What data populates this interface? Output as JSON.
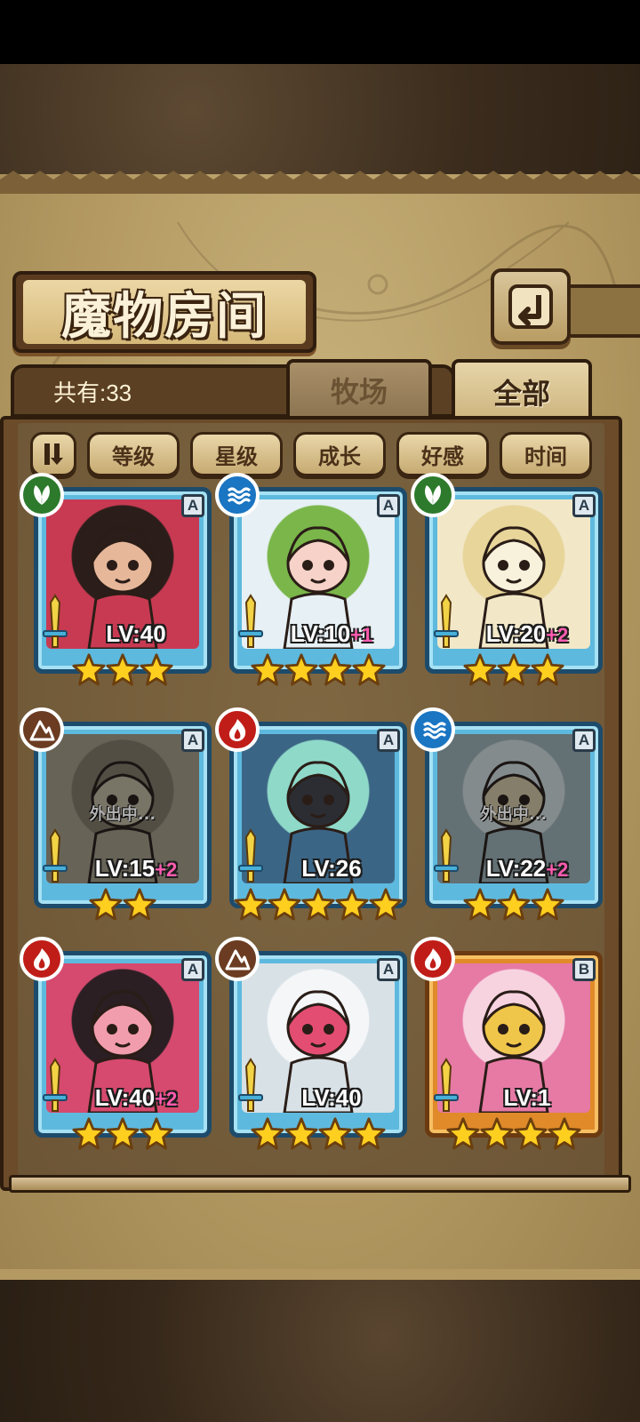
{
  "header": {
    "title": "魔物房间",
    "back_icon": "return-icon"
  },
  "count": {
    "label": "共有:33"
  },
  "tabs": [
    {
      "label": "牧场",
      "active": false
    },
    {
      "label": "全部",
      "active": true
    }
  ],
  "sort_buttons": [
    {
      "label": "等级"
    },
    {
      "label": "星级"
    },
    {
      "label": "成长"
    },
    {
      "label": "好感"
    },
    {
      "label": "时间"
    }
  ],
  "monsters": [
    {
      "element": "nature",
      "rank": "A",
      "level": "LV:40",
      "bonus": "",
      "stars": 3,
      "away": false,
      "away_label": "",
      "frame": "blue",
      "colors": [
        "#c83a52",
        "#2b1e1a",
        "#e7b79a"
      ]
    },
    {
      "element": "water",
      "rank": "A",
      "level": "LV:10",
      "bonus": "+1",
      "stars": 4,
      "away": false,
      "away_label": "",
      "frame": "blue",
      "colors": [
        "#e7f0f4",
        "#7ab64a",
        "#f6d2c8"
      ]
    },
    {
      "element": "nature",
      "rank": "A",
      "level": "LV:20",
      "bonus": "+2",
      "stars": 3,
      "away": false,
      "away_label": "",
      "frame": "blue",
      "colors": [
        "#f2e8c8",
        "#e8d59a",
        "#f8f2dc"
      ]
    },
    {
      "element": "earth",
      "rank": "A",
      "level": "LV:15",
      "bonus": "+2",
      "stars": 2,
      "away": true,
      "away_label": "外出中...",
      "frame": "blue",
      "colors": [
        "#9a8d6c",
        "#7d6f52",
        "#b3a57f"
      ]
    },
    {
      "element": "fire",
      "rank": "A",
      "level": "LV:26",
      "bonus": "",
      "stars": 5,
      "away": false,
      "away_label": "",
      "frame": "blue",
      "colors": [
        "#3b6585",
        "#8fd9c9",
        "#2b2d33"
      ]
    },
    {
      "element": "water",
      "rank": "A",
      "level": "LV:22",
      "bonus": "+2",
      "stars": 3,
      "away": true,
      "away_label": "外出中...",
      "frame": "blue",
      "colors": [
        "#7fa3b0",
        "#b3c8cf",
        "#c9b47a"
      ]
    },
    {
      "element": "fire",
      "rank": "A",
      "level": "LV:40",
      "bonus": "+2",
      "stars": 3,
      "away": false,
      "away_label": "",
      "frame": "blue",
      "colors": [
        "#d64a6f",
        "#2b1f24",
        "#f29dae"
      ]
    },
    {
      "element": "earth",
      "rank": "A",
      "level": "LV:40",
      "bonus": "",
      "stars": 4,
      "away": false,
      "away_label": "",
      "frame": "blue",
      "colors": [
        "#d8e1e6",
        "#f4f6f8",
        "#e44d72"
      ]
    },
    {
      "element": "fire",
      "rank": "B",
      "level": "LV:1",
      "bonus": "",
      "stars": 4,
      "away": false,
      "away_label": "",
      "frame": "gold",
      "colors": [
        "#e67aa4",
        "#f7d3e0",
        "#f0c64a"
      ]
    }
  ]
}
